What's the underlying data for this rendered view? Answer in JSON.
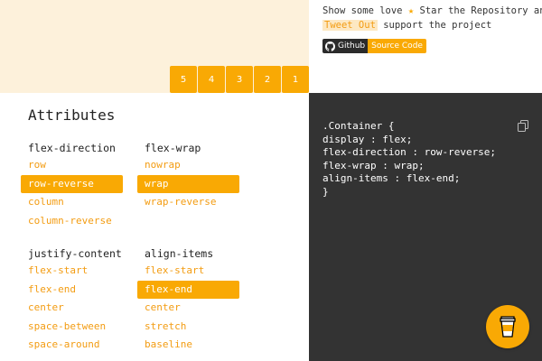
{
  "preview": {
    "items": [
      "1",
      "2",
      "3",
      "4",
      "5"
    ]
  },
  "info": {
    "line1_pre": "Show some love",
    "star": "★",
    "line1_post": "Star the Repository and",
    "tweet": "Tweet Out",
    "line2_post": "support the project",
    "badge_left": "Github",
    "badge_right": "Source Code"
  },
  "attributes": {
    "title": "Attributes",
    "groups": [
      {
        "title": "flex-direction",
        "options": [
          "row",
          "row-reverse",
          "column",
          "column-reverse"
        ],
        "selected": "row-reverse"
      },
      {
        "title": "flex-wrap",
        "options": [
          "nowrap",
          "wrap",
          "wrap-reverse"
        ],
        "selected": "wrap"
      },
      {
        "title": "justify-content",
        "options": [
          "flex-start",
          "flex-end",
          "center",
          "space-between",
          "space-around"
        ],
        "selected": ""
      },
      {
        "title": "align-items",
        "options": [
          "flex-start",
          "flex-end",
          "center",
          "stretch",
          "baseline"
        ],
        "selected": "flex-end"
      }
    ]
  },
  "code": {
    "lines": [
      ".Container {",
      "display : flex;",
      "flex-direction : row-reverse;",
      "flex-wrap : wrap;",
      "align-items : flex-end;",
      "}"
    ]
  },
  "colors": {
    "accent": "#f9a904",
    "preview_bg": "#fdf1db",
    "code_bg": "#333333"
  },
  "icons": {
    "github": "github-icon",
    "copy": "copy-icon",
    "cup": "coffee-cup-icon"
  }
}
